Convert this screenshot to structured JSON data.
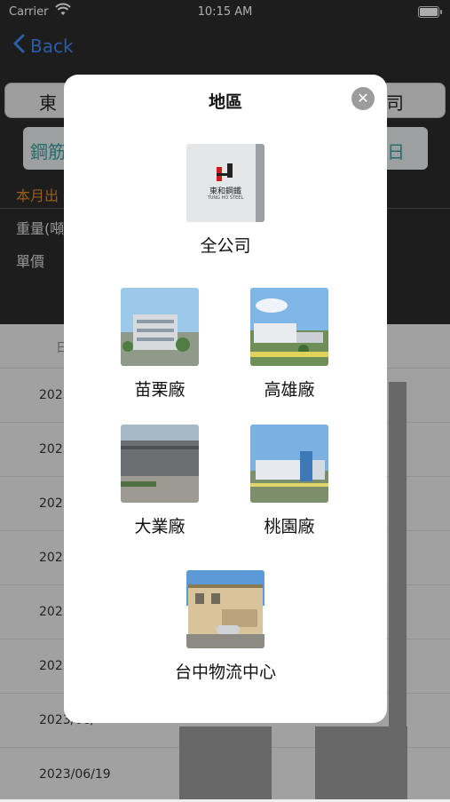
{
  "status": {
    "carrier": "Carrier",
    "time": "10:15 AM"
  },
  "nav": {
    "back": "Back"
  },
  "background": {
    "segment_left": "東",
    "segment_right": "司",
    "field_left": "鋼筋",
    "field_right": "日",
    "month_label": "本月出",
    "weight_label": "重量(噸",
    "price_label": "單價",
    "col_header": "日",
    "rows": [
      "2023",
      "2023",
      "2023",
      "2023",
      "2023",
      "2023",
      "2023/06/",
      "2023/06/19"
    ]
  },
  "modal": {
    "title": "地區",
    "regions": [
      {
        "label": "全公司",
        "logo_text": "東和鋼鐵",
        "logo_sub": "TUNG HO STEEL"
      },
      {
        "label": "苗栗廠"
      },
      {
        "label": "高雄廠"
      },
      {
        "label": "大業廠"
      },
      {
        "label": "桃園廠"
      },
      {
        "label": "台中物流中心"
      }
    ]
  },
  "colors": {
    "accent": "#3d8af7",
    "orange": "#e08a1c",
    "teal": "#3aa0a0"
  },
  "icons": {
    "wifi": "wifi-icon",
    "battery": "battery-icon",
    "back": "chevron-left-icon",
    "close": "close-icon"
  }
}
